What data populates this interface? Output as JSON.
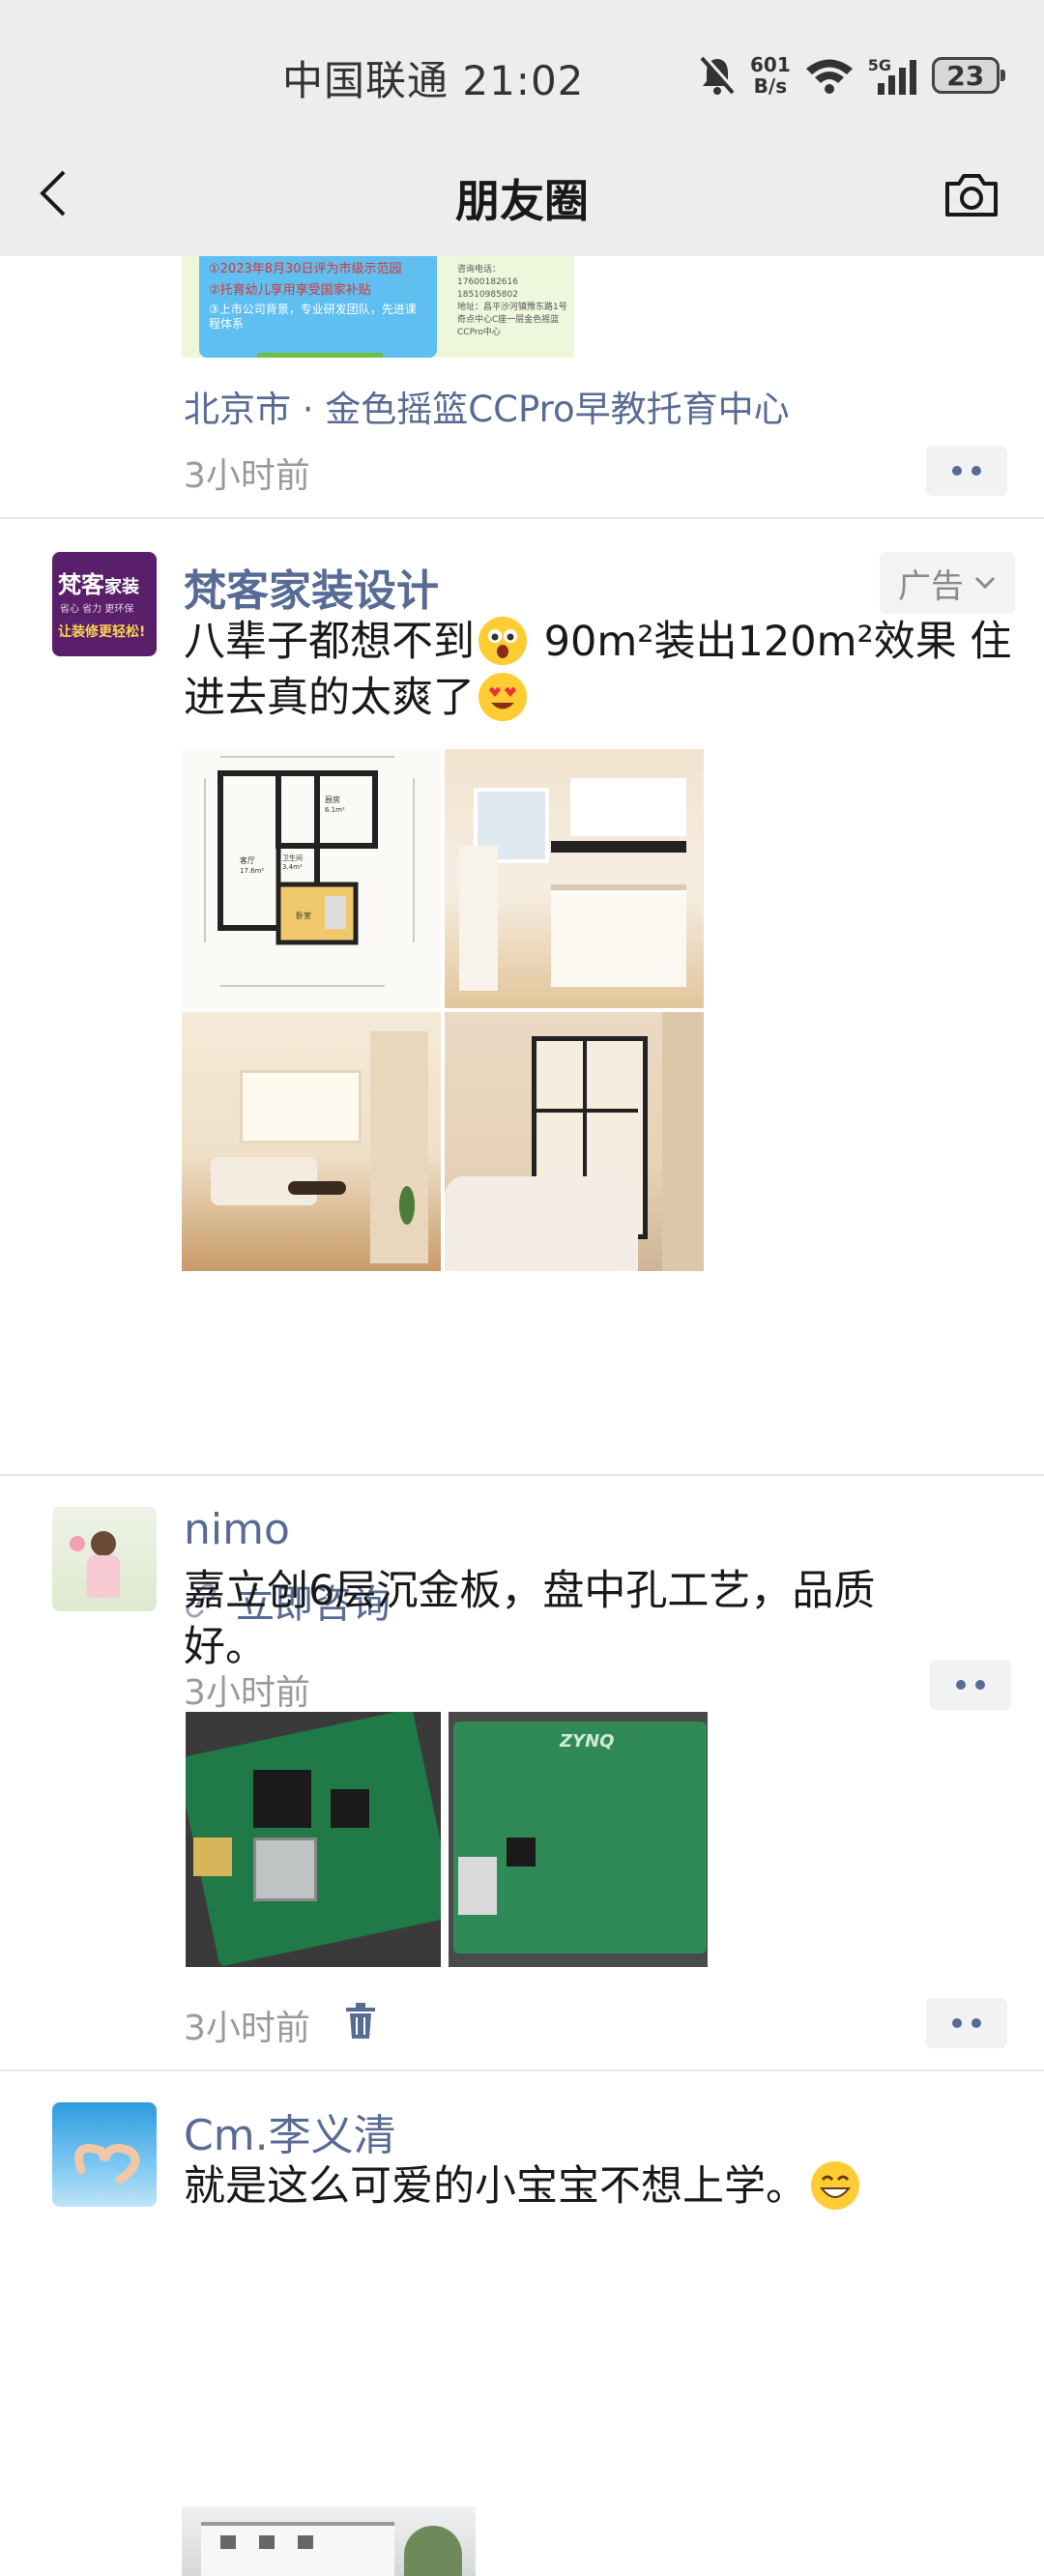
{
  "status_bar": {
    "carrier_time": "中国联通 21:02",
    "net_speed_value": "601",
    "net_speed_unit": "B/s",
    "signal_label": "5G",
    "battery": "23"
  },
  "nav": {
    "title": "朋友圈"
  },
  "posts": [
    {
      "partial_image_text": [
        "①2023年8月30日评为市级示范园",
        "②托育幼儿享用享受国家补贴",
        "③上市公司背景，专业研发团队，先进课程体系"
      ],
      "contact_lines": [
        "咨询电话：",
        "17600182616",
        "18510985802",
        "地址：昌平沙河镇豫东路1号奇点中心C座一层金色摇篮CCPro中心"
      ],
      "location": "北京市 · 金色摇篮CCPro早教托育中心",
      "time": "3小时前"
    },
    {
      "name": "梵客家装设计",
      "avatar_text_1": "梵客",
      "avatar_text_2": "家装",
      "avatar_text_3": "省心 省力 更环保",
      "avatar_text_4": "让装修更轻松!",
      "ad_tag": "广告",
      "text_line1_a": "八辈子都想不到",
      "text_line1_b": " 90m²装出120m²效果 住",
      "text_line2": "进去真的太爽了",
      "floorplan_labels": [
        "厨房",
        "6.1m²",
        "卫生间",
        "3.4m²",
        "客厅",
        "17.6m²",
        "卧室"
      ],
      "link_text": "立即咨询",
      "time": "3小时前"
    },
    {
      "name": "nimo",
      "text": "嘉立创6层沉金板，盘中孔工艺，品质好。",
      "board_label": "ZYNQ",
      "time": "3小时前"
    },
    {
      "name": "Cm.李义清",
      "text": "就是这么可爱的小宝宝不想上学。"
    }
  ],
  "icons": [
    "back-arrow-icon",
    "camera-icon",
    "mute-bell-icon",
    "wifi-icon",
    "signal-icon",
    "battery-icon",
    "link-icon",
    "delete-icon",
    "chevron-down-icon",
    "more-icon"
  ]
}
